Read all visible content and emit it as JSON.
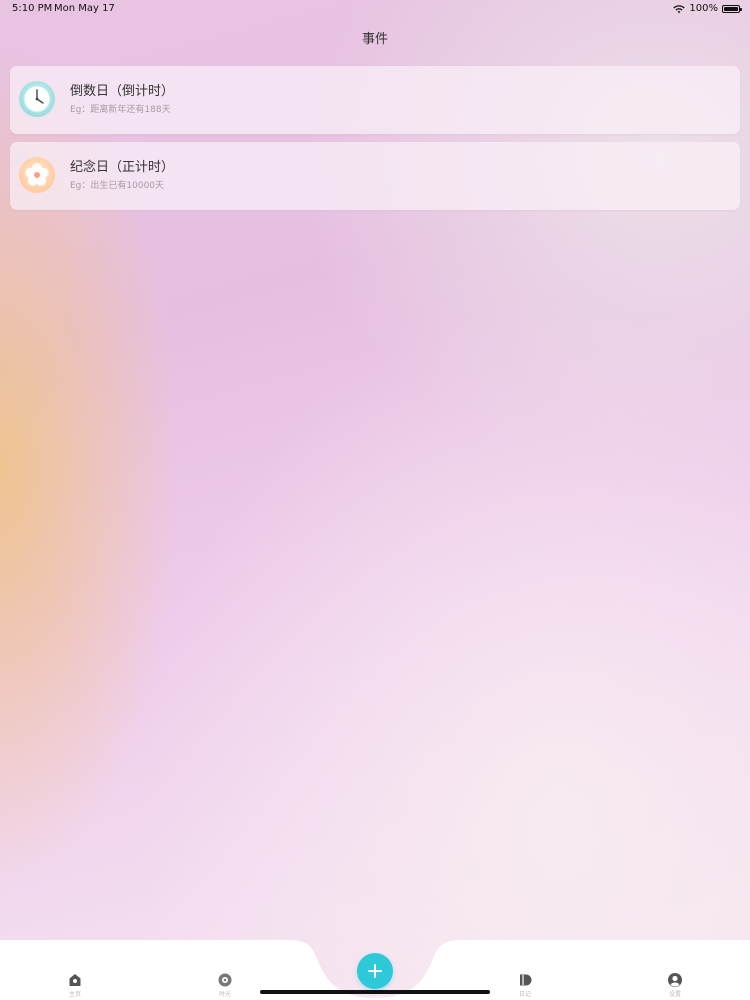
{
  "status_bar": {
    "time": "5:10 PM",
    "date": "Mon May 17",
    "battery": "100%"
  },
  "header": {
    "title": "事件"
  },
  "events": [
    {
      "icon": "clock-icon",
      "title": "倒数日（倒计时）",
      "subtitle": "Eg：距离新年还有188天"
    },
    {
      "icon": "flower-icon",
      "title": "纪念日（正计时）",
      "subtitle": "Eg：出生已有10000天"
    }
  ],
  "tabs": [
    {
      "icon": "home-icon",
      "label": "主页"
    },
    {
      "icon": "time-icon",
      "label": "时光"
    },
    {
      "icon": "diary-icon",
      "label": "日记"
    },
    {
      "icon": "settings-icon",
      "label": "设置"
    }
  ],
  "add_button": {
    "icon": "plus-icon"
  },
  "colors": {
    "accent": "#2ec9d9",
    "tab_label": "#bbbbbb",
    "subtitle": "#a89aa6"
  }
}
